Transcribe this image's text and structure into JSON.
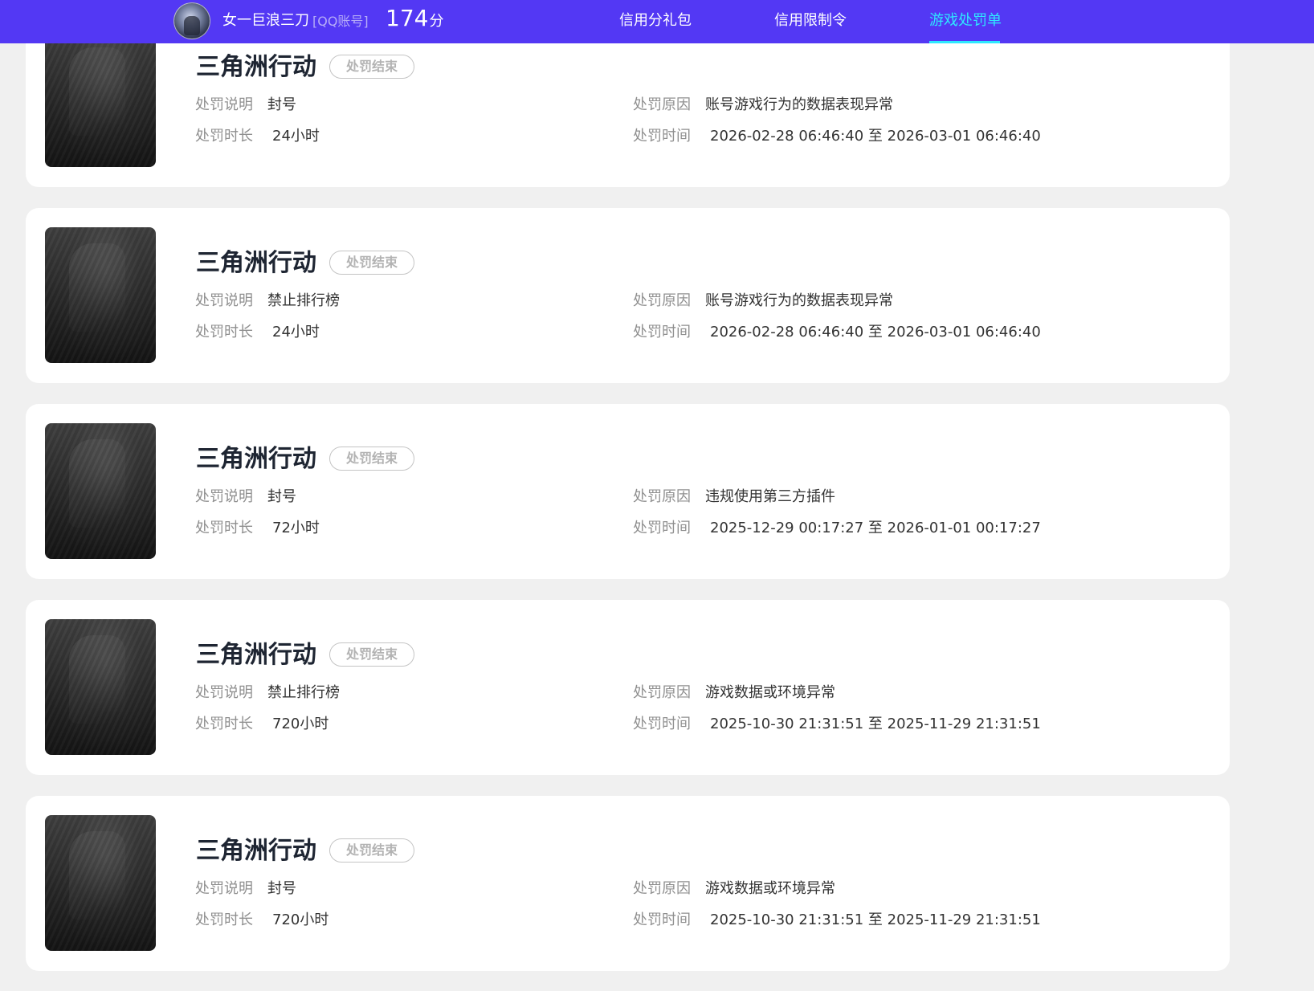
{
  "header": {
    "user_name": "女一巨浪三刀",
    "account_type": "[QQ账号]",
    "score": "174",
    "score_unit": "分",
    "accent_color": "#5338f4",
    "active_color": "#2ee8ff",
    "tabs": [
      {
        "label": "信用分礼包",
        "active": false
      },
      {
        "label": "信用限制令",
        "active": false
      },
      {
        "label": "游戏处罚单",
        "active": true
      }
    ]
  },
  "labels": {
    "description": "处罚说明",
    "duration": "处罚时长",
    "reason": "处罚原因",
    "time": "处罚时间"
  },
  "punishments": [
    {
      "game": "三角洲行动",
      "status": "处罚结束",
      "description": "封号",
      "duration": "24小时",
      "reason": "账号游戏行为的数据表现异常",
      "time": "2026-02-28 06:46:40 至 2026-03-01 06:46:40"
    },
    {
      "game": "三角洲行动",
      "status": "处罚结束",
      "description": "禁止排行榜",
      "duration": "24小时",
      "reason": "账号游戏行为的数据表现异常",
      "time": "2026-02-28 06:46:40 至 2026-03-01 06:46:40"
    },
    {
      "game": "三角洲行动",
      "status": "处罚结束",
      "description": "封号",
      "duration": "72小时",
      "reason": "违规使用第三方插件",
      "time": "2025-12-29 00:17:27 至 2026-01-01 00:17:27"
    },
    {
      "game": "三角洲行动",
      "status": "处罚结束",
      "description": "禁止排行榜",
      "duration": "720小时",
      "reason": "游戏数据或环境异常",
      "time": "2025-10-30 21:31:51 至 2025-11-29 21:31:51"
    },
    {
      "game": "三角洲行动",
      "status": "处罚结束",
      "description": "封号",
      "duration": "720小时",
      "reason": "游戏数据或环境异常",
      "time": "2025-10-30 21:31:51 至 2025-11-29 21:31:51"
    }
  ]
}
